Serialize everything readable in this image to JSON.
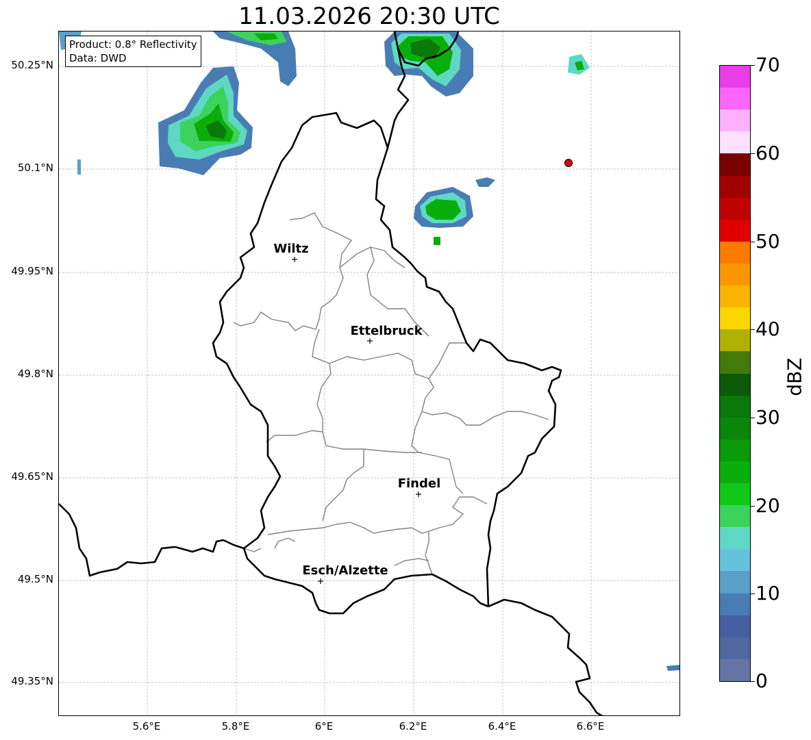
{
  "title": "11.03.2026 20:30 UTC",
  "info_box": {
    "product": "Product: 0.8° Reflectivity",
    "data": "Data: DWD"
  },
  "lat_labels": [
    "50.25°N",
    "50.1°N",
    "49.95°N",
    "49.8°N",
    "49.65°N",
    "49.5°N",
    "49.35°N"
  ],
  "lon_labels": [
    "5.6°E",
    "5.8°E",
    "6°E",
    "6.2°E",
    "6.4°E",
    "6.6°E"
  ],
  "cities": [
    {
      "name": "Wiltz"
    },
    {
      "name": "Ettelbruck"
    },
    {
      "name": "Findel"
    },
    {
      "name": "Esch/Alzette"
    }
  ],
  "colorbar": {
    "label": "dBZ",
    "ticks": [
      "70",
      "60",
      "50",
      "40",
      "30",
      "20",
      "10",
      "0"
    ],
    "colors": [
      "#e83de8",
      "#fc66fc",
      "#fcb0fc",
      "#fde0fd",
      "#780000",
      "#a00000",
      "#c00000",
      "#e00000",
      "#fc7a00",
      "#fc9600",
      "#fcb200",
      "#fcd600",
      "#b0b000",
      "#447a0a",
      "#0a5a0a",
      "#0a780a",
      "#0a860a",
      "#0a9a0a",
      "#0aae0a",
      "#10c818",
      "#3cd25c",
      "#5ed8c4",
      "#66c2dc",
      "#58a0c8",
      "#4a7cb4",
      "#4460a0",
      "#5068a0",
      "#6474a4"
    ]
  },
  "colors": {
    "border": "#000000",
    "cantons": "#808080",
    "grid": "#b0b0b0",
    "station_marker": "#e00000"
  }
}
